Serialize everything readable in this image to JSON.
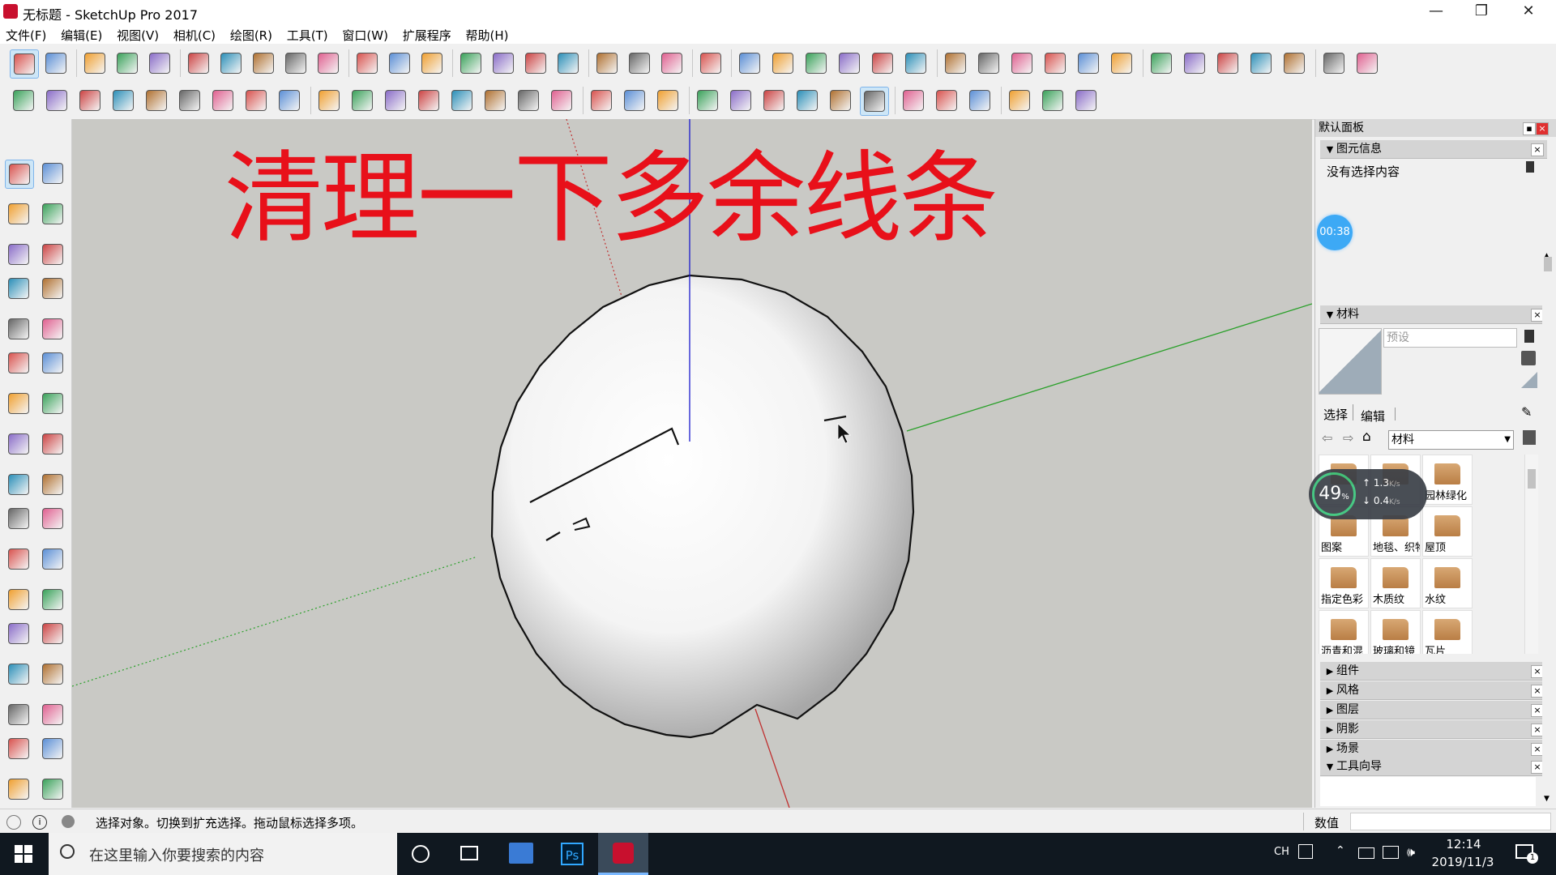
{
  "window": {
    "title": "无标题 - SketchUp Pro 2017",
    "minimize": "—",
    "restore": "❐",
    "close": "✕"
  },
  "menu": [
    "文件(F)",
    "编辑(E)",
    "视图(V)",
    "相机(C)",
    "绘图(R)",
    "工具(T)",
    "窗口(W)",
    "扩展程序",
    "帮助(H)"
  ],
  "icons": {
    "top_row1": [
      "select-icon",
      "eraser-icon",
      "pencil-icon",
      "arc-icon",
      "circle-icon",
      "push-pull-icon",
      "follow-me-icon",
      "move-icon",
      "rotate-icon",
      "scale-icon",
      "tape-measure-icon",
      "text-icon",
      "paint-bucket-icon",
      "orbit-icon",
      "pan-icon",
      "zoom-icon",
      "zoom-extents-icon",
      "warehouse-icon",
      "extension-warehouse-icon",
      "send-to-layout-icon",
      "ruby-icon",
      "iso-view-icon",
      "top-view-icon",
      "front-view-icon",
      "right-view-icon",
      "back-view-icon",
      "left-view-icon",
      "xray-icon",
      "wireframe-icon",
      "hidden-line-icon",
      "shaded-icon",
      "shaded-texture-icon",
      "monochrome-icon",
      "sun-icon",
      "fog-icon",
      "section-plane-icon",
      "section-cut-icon",
      "section-fill-icon",
      "sandbox-icon",
      "drape-icon"
    ],
    "top_row2": [
      "plugin-1-icon",
      "plugin-2-icon",
      "plugin-3-icon",
      "plugin-4-icon",
      "plugin-5-icon",
      "plugin-6-icon",
      "plugin-7-icon",
      "plugin-8-icon",
      "plugin-9-icon",
      "plugin-10-icon",
      "plugin-11-icon",
      "plugin-12-icon",
      "plugin-13-icon",
      "plugin-14-icon",
      "plugin-15-icon",
      "plugin-16-icon",
      "plugin-17-icon",
      "plugin-18-icon",
      "plugin-19-icon",
      "plugin-20-icon",
      "plugin-21-icon",
      "plugin-22-icon",
      "plugin-23-icon",
      "plugin-24-icon",
      "plugin-25-icon",
      "plugin-26-icon",
      "vray-icon",
      "teapot-icon",
      "render-icon",
      "frame-icon",
      "camera-icon",
      "lock-icon"
    ],
    "left": [
      "select-icon",
      "component-icon",
      "paint-bucket-icon",
      "eraser-icon",
      "pencil-icon",
      "freehand-icon",
      "rectangle-icon",
      "rotated-rect-icon",
      "circle-icon",
      "polygon-icon",
      "arc-icon",
      "arc-2pt-icon",
      "arc-3pt-icon",
      "pie-icon",
      "move-icon",
      "push-pull-icon",
      "rotate-icon",
      "follow-me-icon",
      "scale-icon",
      "offset-icon",
      "tape-measure-icon",
      "dimension-icon",
      "protractor-icon",
      "text-icon",
      "axes-icon",
      "3d-text-icon",
      "orbit-icon",
      "pan-icon",
      "zoom-icon",
      "zoom-window-icon",
      "zoom-extents-icon",
      "previous-view-icon",
      "position-camera-icon",
      "look-around-icon",
      "walk-icon",
      "section-plane-icon"
    ]
  },
  "colors": {
    "annotation": "#e8101a",
    "accent_select": "#cde6f7",
    "blue_axis": "#1a1acc",
    "red_axis": "#c03030",
    "green_axis": "#2aa02a"
  },
  "viewport": {
    "annotation_text": "清理一下多余线条"
  },
  "panel": {
    "title": "默认面板",
    "entity_info": {
      "header": "图元信息",
      "value": "没有选择内容"
    },
    "timer": "00:38",
    "materials": {
      "header": "材料",
      "name_placeholder": "预设",
      "tab_select": "选择",
      "tab_edit": "编辑",
      "collection": "材料",
      "items": [
        "",
        "",
        "园林绿化",
        "图案",
        "地毯、织物",
        "屋顶",
        "指定色彩",
        "木质纹",
        "水纹",
        "沥青和混",
        "玻璃和镜",
        "瓦片"
      ]
    },
    "net_widget": {
      "percent": "49",
      "percent_sign": "%",
      "up": "1.3",
      "up_unit": "K/s",
      "down": "0.4",
      "down_unit": "K/s"
    },
    "collapsed_sections": [
      "组件",
      "风格",
      "图层",
      "阴影",
      "场景"
    ],
    "instructor": "工具向导"
  },
  "statusbar": {
    "message": "选择对象。切换到扩充选择。拖动鼠标选择多项。",
    "measure_label": "数值"
  },
  "taskbar": {
    "search_placeholder": "在这里输入你要搜索的内容",
    "ime": "CH",
    "time": "12:14",
    "date": "2019/11/3",
    "notification_count": "1"
  }
}
